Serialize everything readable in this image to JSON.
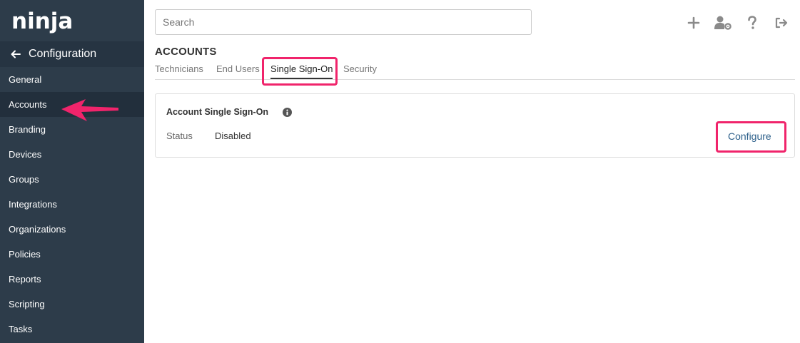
{
  "app": {
    "logo_text": "ninja"
  },
  "sidebar": {
    "header_title": "Configuration",
    "items": [
      {
        "label": "General"
      },
      {
        "label": "Accounts"
      },
      {
        "label": "Branding"
      },
      {
        "label": "Devices"
      },
      {
        "label": "Groups"
      },
      {
        "label": "Integrations"
      },
      {
        "label": "Organizations"
      },
      {
        "label": "Policies"
      },
      {
        "label": "Reports"
      },
      {
        "label": "Scripting"
      },
      {
        "label": "Tasks"
      }
    ],
    "active_item": "Accounts"
  },
  "search": {
    "placeholder": "Search",
    "value": ""
  },
  "toolbar": {
    "icons": [
      "plus-icon",
      "user-settings-icon",
      "help-icon",
      "logout-icon"
    ]
  },
  "page": {
    "title": "ACCOUNTS"
  },
  "tabs": [
    {
      "label": "Technicians"
    },
    {
      "label": "End Users"
    },
    {
      "label": "Single Sign-On",
      "active": true
    },
    {
      "label": "Security"
    }
  ],
  "sso_card": {
    "title": "Account Single Sign-On",
    "status_label": "Status",
    "status_value": "Disabled",
    "configure_label": "Configure"
  },
  "colors": {
    "sidebar_bg": "#2d3c4a",
    "highlight": "#f0246b",
    "link": "#2c5f8a"
  }
}
